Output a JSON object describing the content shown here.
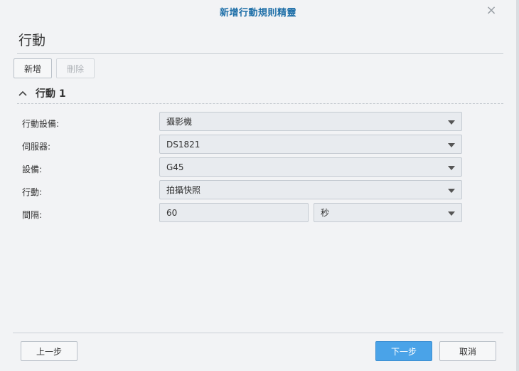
{
  "dialog": {
    "title": "新增行動規則精靈",
    "close_glyph": "×"
  },
  "page_title": "行動",
  "toolbar": {
    "add_label": "新增",
    "delete_label": "刪除"
  },
  "section": {
    "label": "行動 1",
    "expanded": true
  },
  "form": {
    "device_type": {
      "label": "行動設備:",
      "value": "攝影機"
    },
    "server": {
      "label": "伺服器:",
      "value": "DS1821"
    },
    "device": {
      "label": "設備:",
      "value": "G45"
    },
    "action": {
      "label": "行動:",
      "value": "拍攝快照"
    },
    "interval": {
      "label": "間隔:",
      "value": "60",
      "unit": "秒"
    }
  },
  "footer": {
    "prev_label": "上一步",
    "next_label": "下一步",
    "cancel_label": "取消"
  },
  "colors": {
    "title": "#1e6fa8",
    "primary_button": "#4aa3e8"
  }
}
